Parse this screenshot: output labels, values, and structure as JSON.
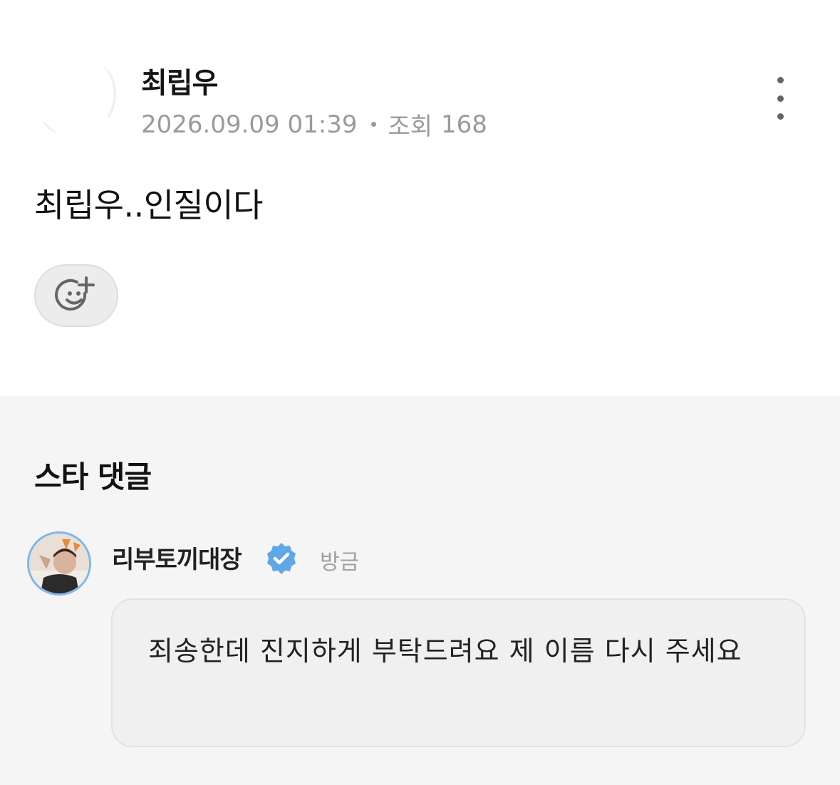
{
  "post": {
    "author_name": "최립우",
    "date": "2026.09.09 01:39",
    "views_label": "조회",
    "views_count": "168",
    "body": "최립우..인질이다",
    "more_icon": "more-vertical-icon",
    "reaction_icon": "add-reaction-icon"
  },
  "comments_section": {
    "title": "스타 댓글",
    "comments": [
      {
        "author": "리부토끼대장",
        "verified": true,
        "time": "방금",
        "text": "죄송한데 진지하게 부탁드려요 제 이름 다시 주세요"
      }
    ]
  },
  "colors": {
    "comments_background": "#f5f5f5",
    "bubble_background": "#f0f0f0",
    "verified_badge": "#5fa7e6",
    "meta_text": "#9a9a9a"
  }
}
